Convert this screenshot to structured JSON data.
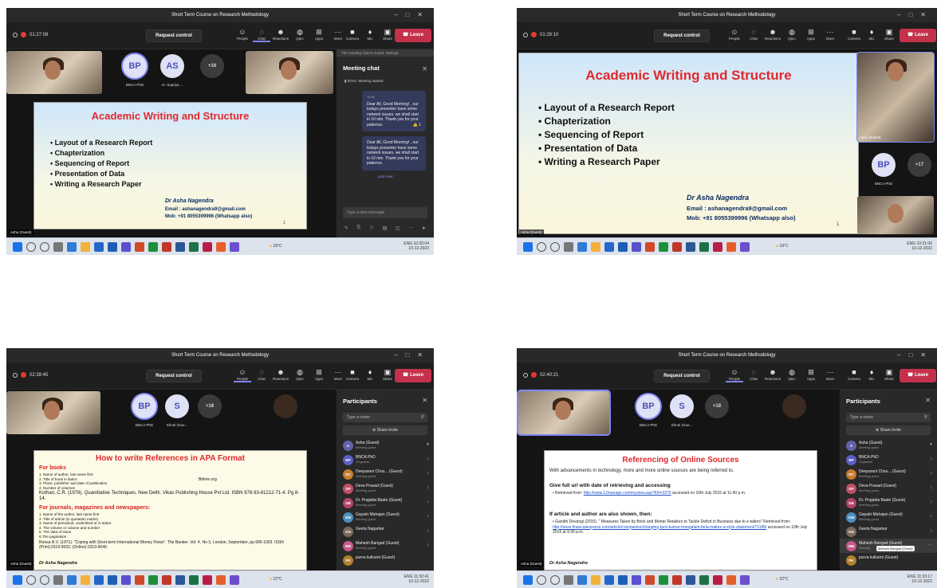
{
  "window_title": "Short Term Course on Research Methodology",
  "toolbar": {
    "request_control": "Request control",
    "buttons": [
      "People",
      "Chat",
      "Reactions",
      "Q&A",
      "Apps",
      "More",
      "Camera",
      "Mic",
      "Share"
    ],
    "leave": "Leave"
  },
  "shots": [
    {
      "timer": "01:27:08",
      "participants": [
        "BNCA PhD",
        "Ar. Supriya ..."
      ],
      "avatars": [
        "BP",
        "AS"
      ],
      "more_count": "+16",
      "presenter_label": "Asha (Guest)",
      "slide": {
        "title": "Academic Writing and Structure",
        "bullets": [
          "Layout of a Research Report",
          "Chapterization",
          "Sequencing of Report",
          "Presentation of Data",
          "Writing a Research Paper"
        ],
        "author": "Dr Asha Nagendra",
        "email": "Email : ashanagendra9@gmail.com",
        "mob": "Mob: +91 8055399996 (Whatsapp also)",
        "page": "1"
      },
      "chat": {
        "mute_note": "The meeting chat is muted. Settings",
        "title": "Meeting chat",
        "started_time": "00:52",
        "started_text": "Meeting started",
        "msg_time": "10:08",
        "message": "Dear All, Good Morning! , our todays presenter have some network issues. we shall start in 10 min. Thank you for your patience.",
        "reaction": "👍 1",
        "last_read": "Last read",
        "input_placeholder": "Type a new message"
      },
      "tray": {
        "weather": "18°C",
        "lang": "ENG",
        "time": "10:20:04",
        "date": "10-12-2022"
      }
    },
    {
      "timer": "01:28:10",
      "presenter_label": "Asha (Guest)",
      "side_label": "Asha (Guest)",
      "avatar": "BP",
      "avatar_name": "BNCA PhD",
      "more_count": "+17",
      "slide": {
        "title": "Academic Writing and Structure",
        "bullets": [
          "Layout of a Research Report",
          "Chapterization",
          "Sequencing of Report",
          "Presentation of Data",
          "Writing a Research Paper"
        ],
        "author": "Dr Asha Nagendra",
        "email": "Email : ashanagendra9@gmail.com",
        "mob": "Mob: +91 8055399996 (Whatsapp also)",
        "page": "1"
      },
      "tray": {
        "weather": "18°C",
        "lang": "ENG",
        "time": "10:21:06",
        "date": "10-12-2022"
      }
    },
    {
      "timer": "02:39:45",
      "participants": [
        "BNCA PhD",
        "Shruti (Gue..."
      ],
      "avatars": [
        "BP",
        "S"
      ],
      "more_count": "+18",
      "presenter_label": "Asha (Guest)",
      "slide": {
        "title": "How to write References in APA Format",
        "h1": "For books",
        "books": [
          "1. Name of author, last name first",
          "2. Title of book in italics",
          "3. Place, publisher and date of publication",
          "4. Number of volumes"
        ],
        "bibme": "Bibme.org",
        "ex1a": "Kothari, C.R. (1978). ",
        "ex1b": "Quantitative Techniques",
        "ex1c": ", New Delhi. Vikas Publishing House Pvt Ltd. ISBN 978-93-81212-71-4. Pg 8-14.",
        "h2": "For journals, magazines and newspapers:",
        "journals": [
          "1. Name of the author, last name first",
          "2. Title of article (in quotation marks)",
          "3. Name of periodical, underlined or in italics",
          "4. The volume or volume and number",
          "5. The data of issue",
          "6.The pagination"
        ],
        "ex2": "Roosa R.V. (1971). \"Coping with Short-term International Money Flows\". The Banker. Vol. 4, No 3, London, September, pp.995-1003. ISSN (Print):2319-9032, (Online):2319-9040.",
        "author": "Dr Asha Nagendra"
      },
      "people": {
        "title": "Participants",
        "search": "Type a name",
        "invite": "Share invite",
        "list": [
          {
            "init": "A",
            "name": "Asha (Guest)",
            "role": "Meeting guest",
            "color": "#6264a7"
          },
          {
            "init": "BP",
            "name": "BNCA PhD",
            "role": "Organizer",
            "color": "#5b5fc7"
          },
          {
            "init": "DC",
            "name": "Deeparani Chou... (Guest)",
            "role": "Meeting guest",
            "color": "#c77b30"
          },
          {
            "init": "DP",
            "name": "Deva Prasad (Guest)",
            "role": "Meeting guest",
            "color": "#c0506a"
          },
          {
            "init": "DB",
            "name": "Dr. Prajakta Baste (Guest)",
            "role": "Meeting guest",
            "color": "#b5446a"
          },
          {
            "init": "GM",
            "name": "Gayatri Mahajan (Guest)",
            "role": "Meeting guest",
            "color": "#4f8fbf"
          },
          {
            "init": "GN",
            "name": "Geeta Nagarkar",
            "role": "",
            "color": "#7a6a5a"
          },
          {
            "init": "MB",
            "name": "Mahesh Bangad (Guest)",
            "role": "Meeting guest",
            "color": "#c75a8a"
          },
          {
            "init": "PK",
            "name": "purva kulkarni (Guest)",
            "role": "",
            "color": "#b08030"
          }
        ]
      },
      "tray": {
        "weather": "22°C",
        "lang": "ENG",
        "time": "11:32:41",
        "date": "10-12-2022"
      }
    },
    {
      "timer": "02:40:21",
      "participants": [
        "BNCA PhD",
        "Shruti (Gue..."
      ],
      "avatars": [
        "BP",
        "S"
      ],
      "more_count": "+18",
      "presenter_label": "Asha (Guest)",
      "slide": {
        "title": "Referencing of Online Sources",
        "intro": "With advancements in technology, more and more online sources are being referred to.",
        "h1": "Give full url with date of retrieving and accessing",
        "b1a": "Retrieved from: ",
        "b1link": "http://www.12manage.com/myview.asp?KN=3375",
        "b1b": " accessed on 10th July 2015 at 11:40 p.m.",
        "h2": "If article and author are also shown, then:",
        "b2a": "Gandhi Devangi (2015). \" Measures Taken by Brick and Mortar Retailers to Tackle Deficit in Business due to e-tailers\" Retrieved from:",
        "b2link": "http://www.financialexpress.com/article/companies/changing-tack-kumar-mangalam-birla-makes-a-style-statement/71188/",
        "b2b": " accessed on 10th July 2015 at 9:30 p.m.",
        "author": "Dr Asha Nagendra"
      },
      "people": {
        "title": "Participants",
        "search": "Type a name",
        "invite": "Share invite",
        "tooltip": "Mahesh Bangad (Guest)",
        "list": [
          {
            "init": "A",
            "name": "Asha (Guest)",
            "role": "Meeting guest",
            "color": "#6264a7"
          },
          {
            "init": "BP",
            "name": "BNCA PhD",
            "role": "Organizer",
            "color": "#5b5fc7"
          },
          {
            "init": "DC",
            "name": "Deeparani Chou... (Guest)",
            "role": "Meeting guest",
            "color": "#c77b30"
          },
          {
            "init": "DP",
            "name": "Deva Prasad (Guest)",
            "role": "Meeting guest",
            "color": "#c0506a"
          },
          {
            "init": "DB",
            "name": "Dr. Prajakta Baste (Guest)",
            "role": "Meeting guest",
            "color": "#b5446a"
          },
          {
            "init": "GM",
            "name": "Gayatri Mahajan (Guest)",
            "role": "Meeting guest",
            "color": "#4f8fbf"
          },
          {
            "init": "GN",
            "name": "Geeta Nagarkar",
            "role": "",
            "color": "#7a6a5a"
          },
          {
            "init": "MB",
            "name": "Mahesh Bangad (Guest)",
            "role": "Meeting",
            "color": "#c75a8a"
          },
          {
            "init": "PK",
            "name": "purva kulkarni (Guest)",
            "role": "",
            "color": "#b08030"
          }
        ]
      },
      "tray": {
        "weather": "22°C",
        "lang": "ENG",
        "time": "11:33:17",
        "date": "10-12-2022"
      }
    }
  ],
  "colors": {
    "leave": "#c4314b",
    "accent": "#7f85f5",
    "slide_title": "#e0292d",
    "teams_bg": "#1f1f1f"
  },
  "icons": [
    "camera-icon",
    "mic-icon",
    "share-icon",
    "people-icon",
    "chat-icon",
    "reactions-icon",
    "qa-icon",
    "apps-icon",
    "more-icon",
    "phone-icon",
    "search-icon",
    "close-icon",
    "mic-off-icon"
  ]
}
